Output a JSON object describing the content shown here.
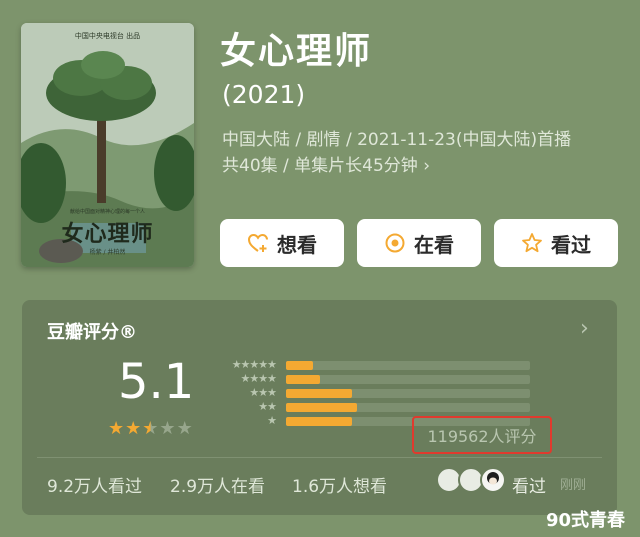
{
  "poster": {
    "top_text": "中国中央电视台 出品",
    "mid_text": "献给中国面对精神心理的每一个人",
    "title": "女心理师",
    "sub_text": "杨紫 / 井柏然"
  },
  "header": {
    "title": "女心理师",
    "year": "(2021)",
    "meta_line1": "中国大陆 / 剧情 / 2021-11-23(中国大陆)首播",
    "meta_line2": "共40集 / 单集片长45分钟",
    "meta_chevron": "›"
  },
  "actions": {
    "want_label": "想看",
    "watching_label": "在看",
    "seen_label": "看过"
  },
  "rating": {
    "title": "豆瓣评分®",
    "score": "5.1",
    "stars_filled": 2.5,
    "stars_total": 5,
    "distribution": [
      {
        "stars": 5,
        "fraction": 0.11
      },
      {
        "stars": 4,
        "fraction": 0.14
      },
      {
        "stars": 3,
        "fraction": 0.27
      },
      {
        "stars": 2,
        "fraction": 0.29
      },
      {
        "stars": 1,
        "fraction": 0.27
      }
    ],
    "count_text": "119562人评分",
    "chevron": "›"
  },
  "stats": {
    "seen": "9.2万人看过",
    "watching": "2.9万人在看",
    "want": "1.6万人想看"
  },
  "friends": {
    "seen_label": "看过",
    "time": "刚刚"
  },
  "watermark": "90式青春",
  "colors": {
    "background": "#7d946c",
    "panel": "#6a7d5c",
    "accent": "#f4a932",
    "highlight_border": "#e03a2e"
  }
}
